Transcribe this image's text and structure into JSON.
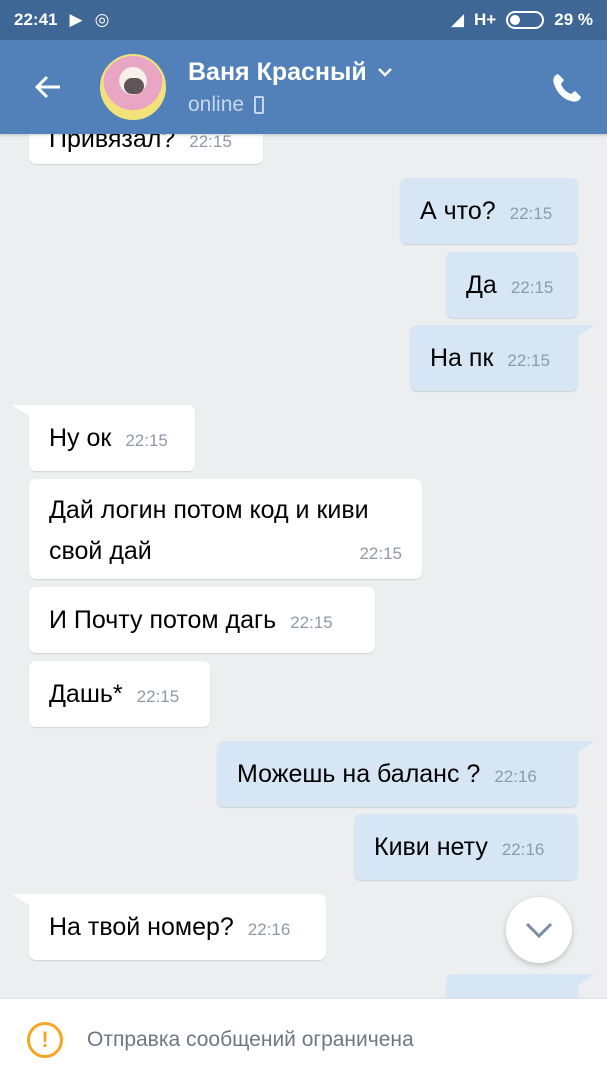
{
  "status_bar": {
    "time": "22:41",
    "network": "H+",
    "battery": "29 %"
  },
  "header": {
    "name": "Ваня Красный",
    "status": "online"
  },
  "messages": [
    {
      "dir": "in",
      "text": "Привязал?",
      "time": "22:15"
    },
    {
      "dir": "out",
      "text": "А что?",
      "time": "22:15"
    },
    {
      "dir": "out",
      "text": "Да",
      "time": "22:15"
    },
    {
      "dir": "out",
      "text": "На пк",
      "time": "22:15"
    },
    {
      "dir": "in",
      "text": "Ну ок",
      "time": "22:15"
    },
    {
      "dir": "in",
      "text_line1": "Дай логин потом код и киви",
      "text_line2": "свой дай",
      "time": "22:15"
    },
    {
      "dir": "in",
      "text": "И Почту потом дагь",
      "time": "22:15"
    },
    {
      "dir": "in",
      "text": "Дашь*",
      "time": "22:15"
    },
    {
      "dir": "out",
      "text": "Можешь на баланс ?",
      "time": "22:16"
    },
    {
      "dir": "out",
      "text": "Киви нету",
      "time": "22:16"
    },
    {
      "dir": "in",
      "text": "На твой номер?",
      "time": "22:16"
    }
  ],
  "bottom_bar": {
    "notice": "Отправка сообщений ограничена"
  },
  "colors": {
    "header": "#5181b8",
    "status_bar": "#3f6795",
    "outgoing_bubble": "#d7e6f5",
    "incoming_bubble": "#ffffff",
    "background": "#edeef0",
    "warning": "#f5a623"
  },
  "icons": [
    "back-arrow-icon",
    "chevron-down-icon",
    "phone-device-icon",
    "call-icon",
    "scroll-down-icon",
    "warning-icon"
  ]
}
